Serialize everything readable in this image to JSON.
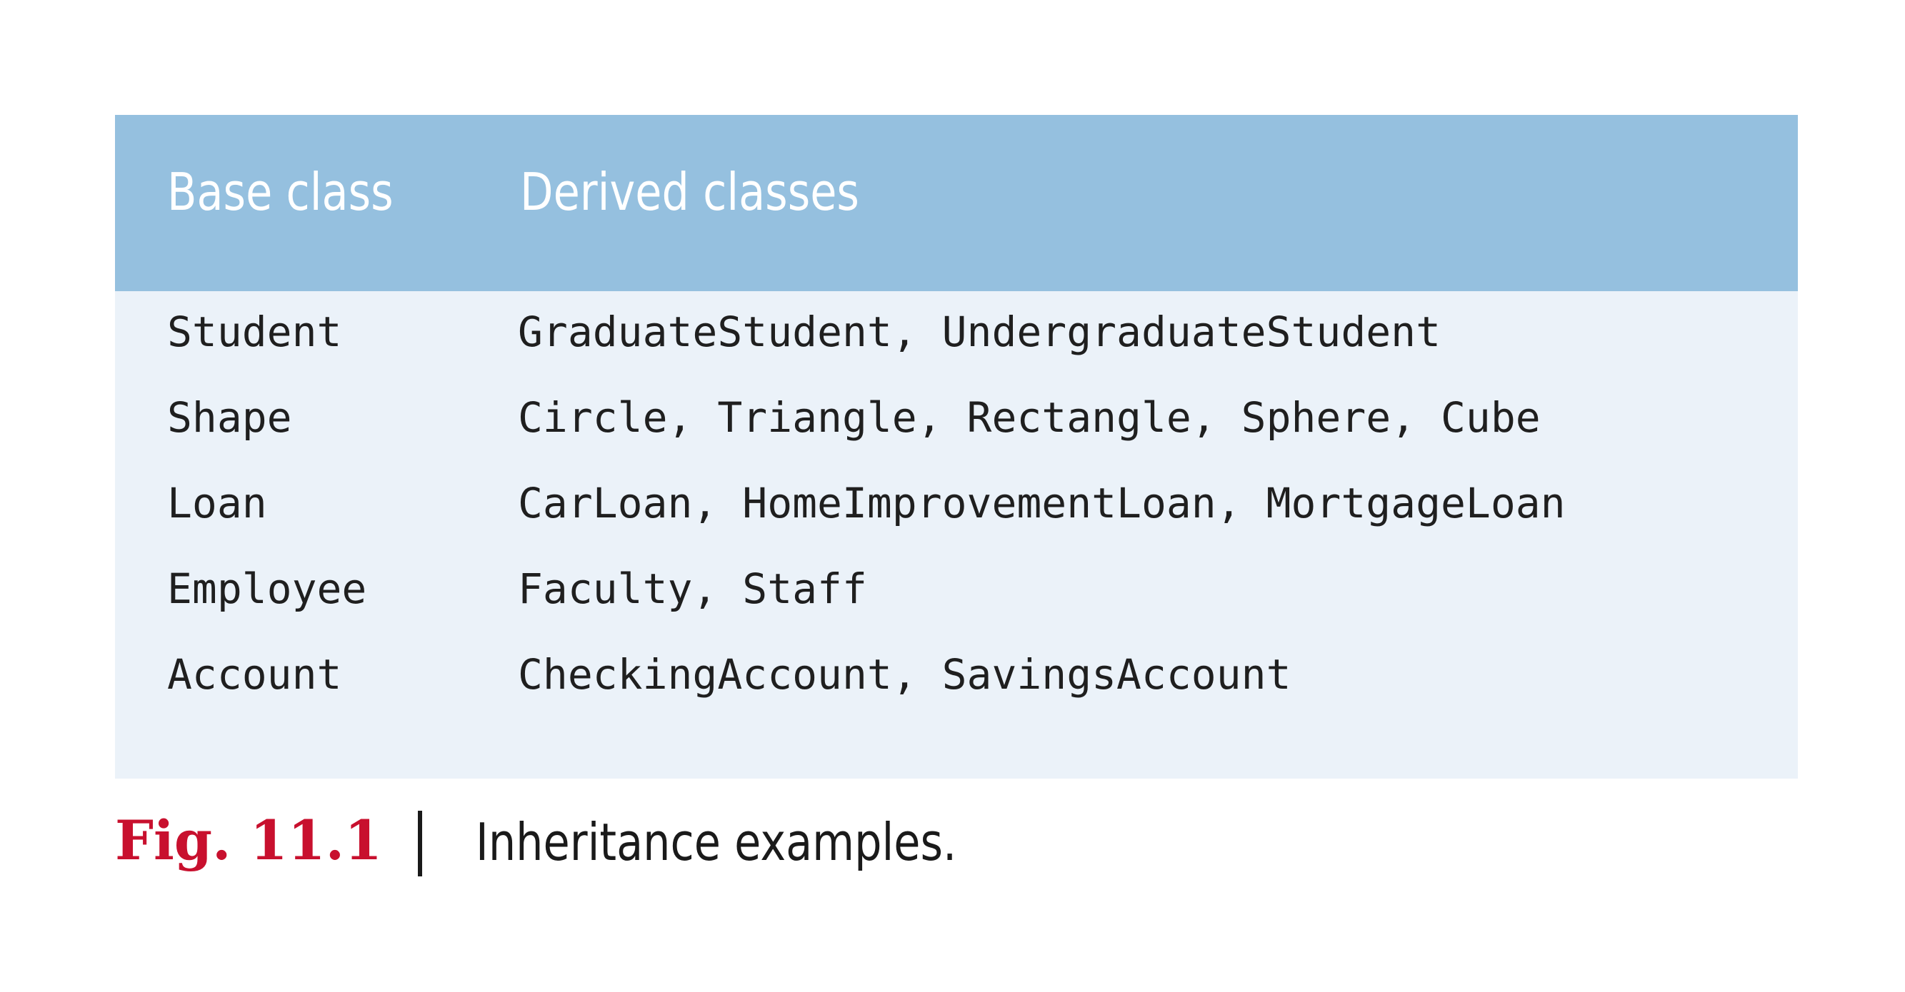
{
  "table": {
    "headers": {
      "base": "Base class",
      "derived": "Derived classes"
    },
    "rows": [
      {
        "base": "Student",
        "derived": "GraduateStudent, UndergraduateStudent"
      },
      {
        "base": "Shape",
        "derived": "Circle, Triangle, Rectangle, Sphere, Cube"
      },
      {
        "base": "Loan",
        "derived": "CarLoan, HomeImprovementLoan, MortgageLoan"
      },
      {
        "base": "Employee",
        "derived": "Faculty, Staff"
      },
      {
        "base": "Account",
        "derived": "CheckingAccount, SavingsAccount"
      }
    ]
  },
  "caption": {
    "figure_number": "Fig. 11.1",
    "text": "Inheritance examples."
  },
  "colors": {
    "header_background": "#95c0df",
    "body_background": "#ebf2f9",
    "figure_number": "#c8102e"
  }
}
